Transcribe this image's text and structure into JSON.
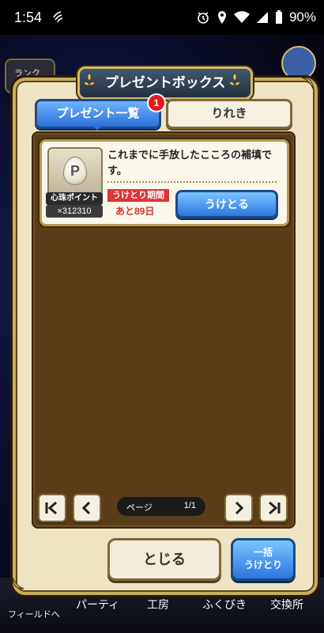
{
  "status": {
    "time": "1:54",
    "battery": "90%"
  },
  "background": {
    "rank_label": "ランク",
    "nav": {
      "field": "フィールドへ",
      "party": "パーティ",
      "workshop": "工房",
      "gacha": "ふくびき",
      "exchange": "交換所"
    }
  },
  "dialog": {
    "title": "プレゼントボックス",
    "tabs": {
      "list": "プレゼント一覧",
      "history": "りれき"
    },
    "badge_count": "1",
    "items": [
      {
        "icon_letter": "P",
        "name": "心珠ポイント",
        "count": "×312310",
        "description": "これまでに手放したこころの補填です。",
        "period_label": "うけとり期間",
        "period_remaining": "あと89日",
        "receive_label": "うけとる"
      }
    ],
    "pager": {
      "label": "ページ",
      "value": "1/1"
    },
    "close_label": "とじる",
    "bulk_line1": "一括",
    "bulk_line2": "うけとり"
  },
  "colors": {
    "blue_button": "#2c77e0",
    "period_red": "#e03434",
    "panel_brown": "#5a3e1a",
    "frame_gold": "#c9ad5c"
  }
}
